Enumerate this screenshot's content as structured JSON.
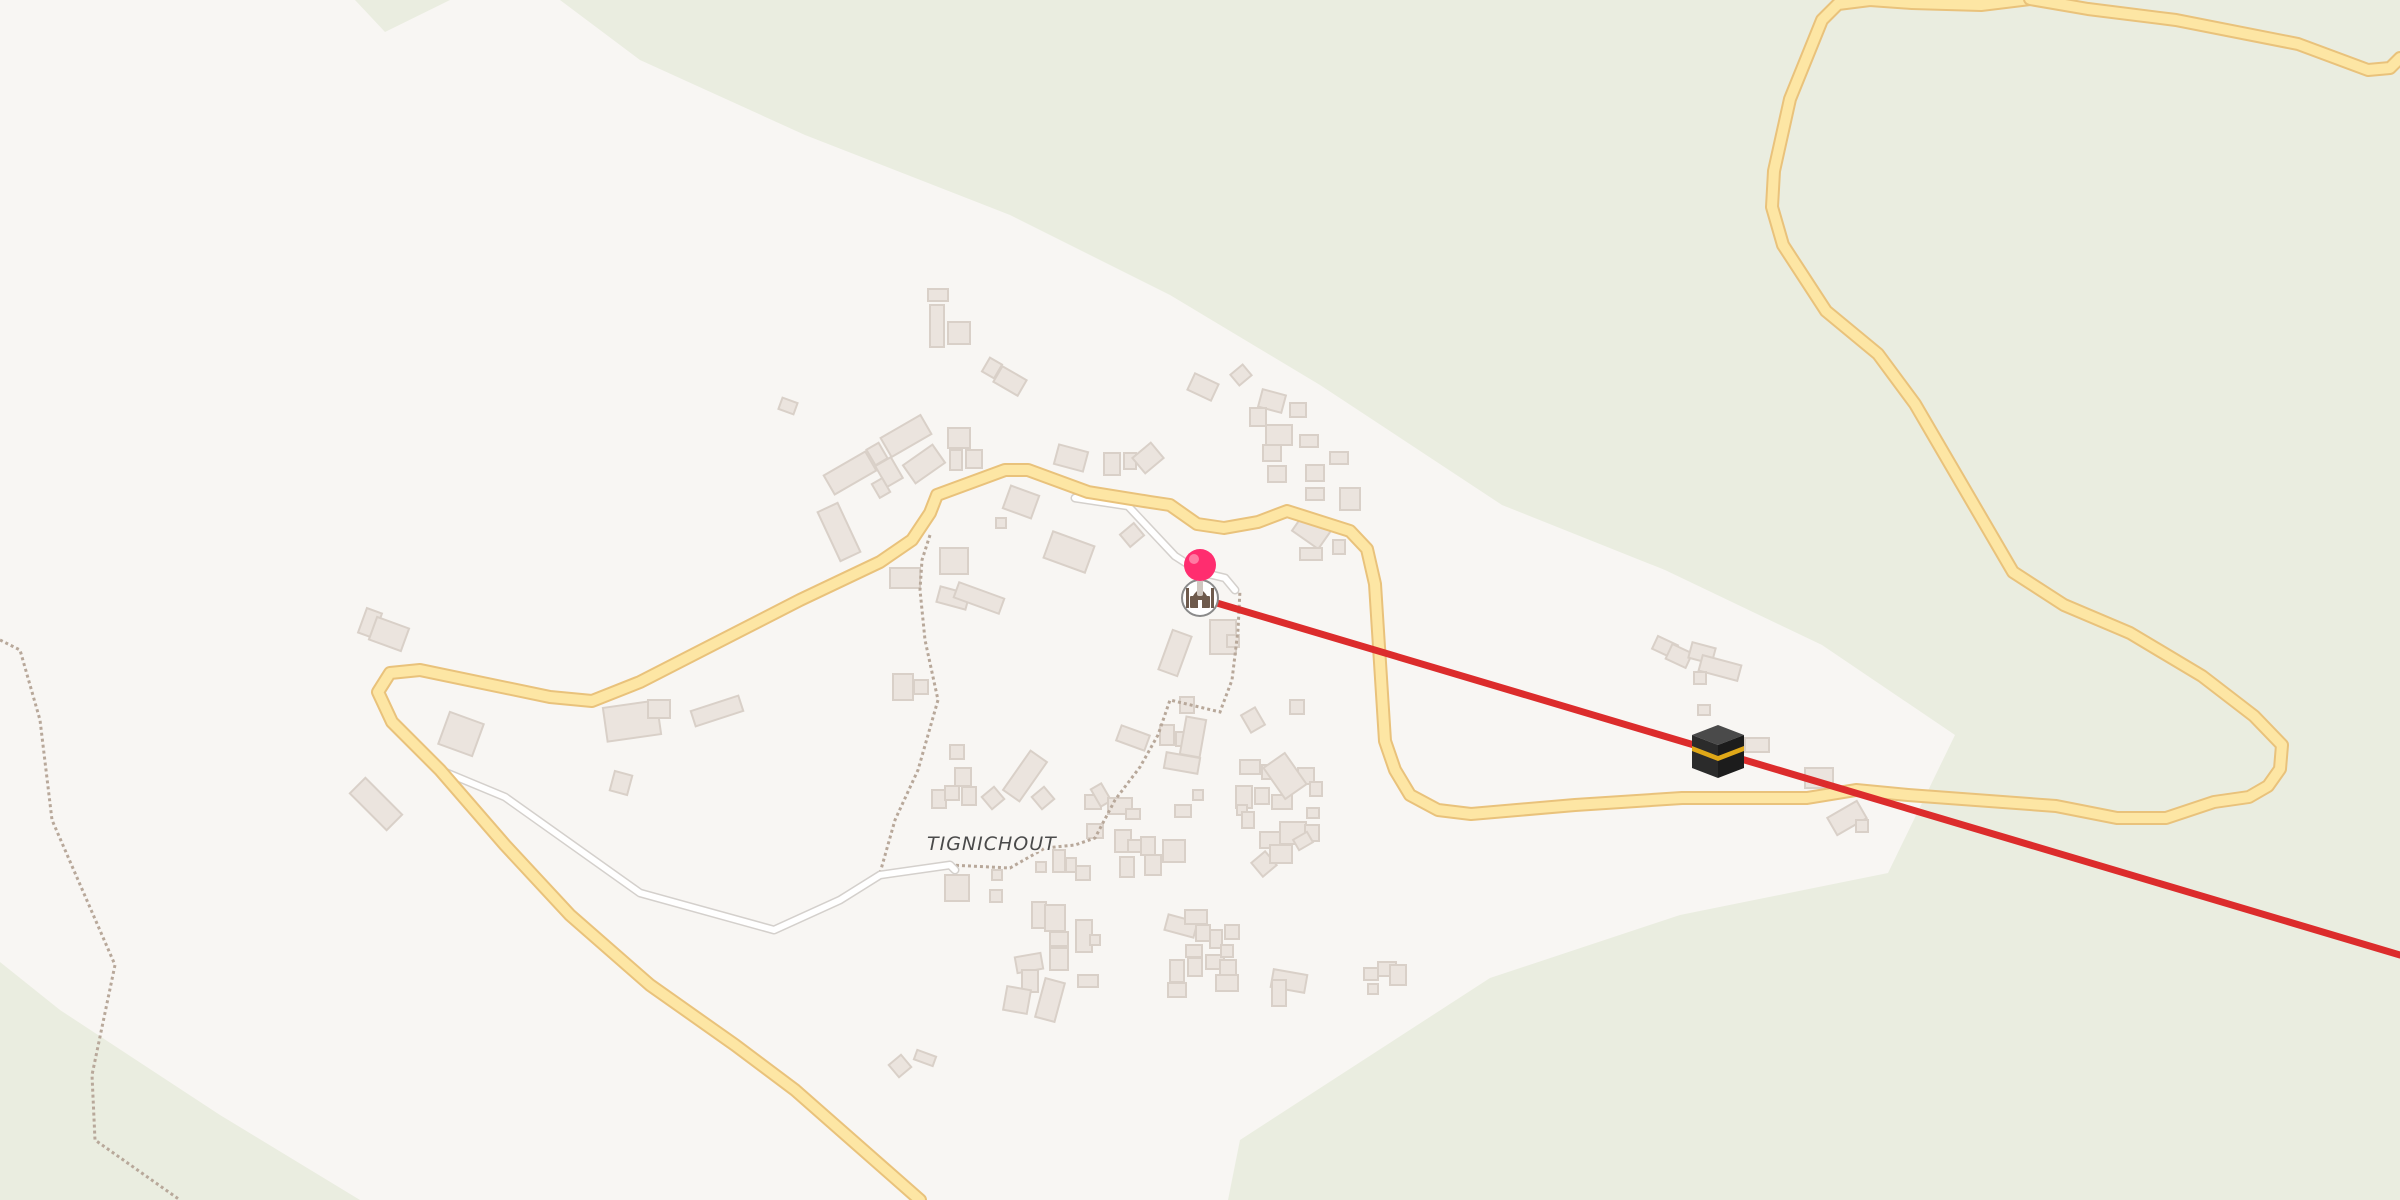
{
  "map": {
    "place_label": "TIGNICHOUT",
    "colors": {
      "background": "#f8f6f3",
      "vegetation": "#eaede0",
      "building_fill": "#ebe4de",
      "building_side": "#d9d0c8",
      "road_fill": "#fde6a4",
      "road_casing": "#e9c27b",
      "track": "#ffffff",
      "footpath": "#b8a89a",
      "direction_line": "#dc2c2c",
      "pin": "#ff2d6f"
    },
    "icons": {
      "location_pin": "map-pin-icon",
      "mosque": "mosque-icon",
      "qibla_target": "kaaba-icon"
    },
    "qibla_line": {
      "description_visible": false
    }
  }
}
